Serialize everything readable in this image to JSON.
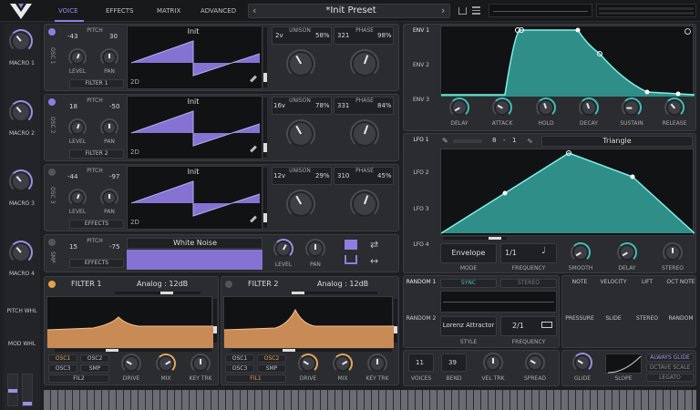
{
  "colors": {
    "accent": "#8f7ee0",
    "teal": "#36a89f",
    "orange": "#d69a5c",
    "bg": "#1e1f22"
  },
  "topbar": {
    "tabs": [
      "VOICE",
      "EFFECTS",
      "MATRIX",
      "ADVANCED"
    ],
    "preset_name": "*Init Preset",
    "prev_arrow": "‹",
    "next_arrow": "›"
  },
  "macros": [
    "MACRO 1",
    "MACRO 2",
    "MACRO 3",
    "MACRO 4"
  ],
  "wheels": [
    "PITCH WHL",
    "MOD WHL"
  ],
  "oscillators": [
    {
      "name": "OSC 1",
      "pitch_label": "PITCH",
      "pitch1": "-43",
      "pitch2": "30",
      "level": "LEVEL",
      "pan": "PAN",
      "route": "FILTER 1",
      "wave": "Init",
      "dim": "2D",
      "voices": "2v",
      "unison": "UNISON",
      "unison_val": "58%",
      "phase": "PHASE",
      "phase1": "321",
      "phase2": "98%"
    },
    {
      "name": "OSC 2",
      "pitch_label": "PITCH",
      "pitch1": "18",
      "pitch2": "-50",
      "level": "LEVEL",
      "pan": "PAN",
      "route": "FILTER 2",
      "wave": "Init",
      "dim": "2D",
      "voices": "16v",
      "unison": "UNISON",
      "unison_val": "78%",
      "phase": "PHASE",
      "phase1": "331",
      "phase2": "84%"
    },
    {
      "name": "OSC 3",
      "pitch_label": "PITCH",
      "pitch1": "-44",
      "pitch2": "-97",
      "level": "LEVEL",
      "pan": "PAN",
      "route": "EFFECTS",
      "wave": "Init",
      "dim": "2D",
      "voices": "12v",
      "unison": "UNISON",
      "unison_val": "29%",
      "phase": "PHASE",
      "phase1": "310",
      "phase2": "45%"
    }
  ],
  "sample": {
    "name": "SMP",
    "pitch_label": "PITCH",
    "pitch1": "15",
    "pitch2": "-75",
    "route": "EFFECTS",
    "source": "White Noise",
    "level": "LEVEL",
    "pan": "PAN"
  },
  "filters": [
    {
      "name": "FILTER 1",
      "model": "Analog : 12dB",
      "srcs": [
        "OSC1",
        "OSC2",
        "OSC3",
        "SMP"
      ],
      "route": "FIL2",
      "k1": "DRIVE",
      "k2": "MIX",
      "k3": "KEY TRK"
    },
    {
      "name": "FILTER 2",
      "model": "Analog : 12dB",
      "srcs": [
        "OSC1",
        "OSC2",
        "OSC3",
        "SMP"
      ],
      "route": "FIL1",
      "k1": "DRIVE",
      "k2": "MIX",
      "k3": "KEY TRK"
    }
  ],
  "env": {
    "tabs": [
      "ENV 1",
      "ENV 2",
      "ENV 3"
    ],
    "knobs": [
      "DELAY",
      "ATTACK",
      "HOLD",
      "DECAY",
      "SUSTAIN",
      "RELEASE"
    ]
  },
  "lfo": {
    "tabs": [
      "LFO 1",
      "LFO 2",
      "LFO 3",
      "LFO 4"
    ],
    "beats": "8",
    "dash": "-",
    "steps": "1",
    "shape": "Triangle",
    "mode_val": "Envelope",
    "mode": "MODE",
    "freq_val": "1/1",
    "freq": "FREQUENCY",
    "k1": "SMOOTH",
    "k2": "DELAY",
    "k3": "STEREO"
  },
  "random": {
    "tabs": [
      "RANDOM 1",
      "RANDOM 2"
    ],
    "sync": "SYNC",
    "stereo": "STEREO",
    "style_val": "Lorenz Attractor",
    "style": "STYLE",
    "freq_val": "2/1",
    "freq": "FREQUENCY"
  },
  "mods": [
    "NOTE",
    "VELOCITY",
    "LIFT",
    "OCT NOTE",
    "PRESSURE",
    "SLIDE",
    "STEREO",
    "RANDOM"
  ],
  "voice": {
    "voices_val": "11",
    "voices": "VOICES",
    "bend_val": "39",
    "bend": "BEND",
    "veltrk": "VEL TRK",
    "spread": "SPREAD",
    "glide": "GLIDE",
    "slope": "SLOPE",
    "opts": [
      "ALWAYS GLIDE",
      "OCTAVE SCALE",
      "LEGATO"
    ]
  }
}
